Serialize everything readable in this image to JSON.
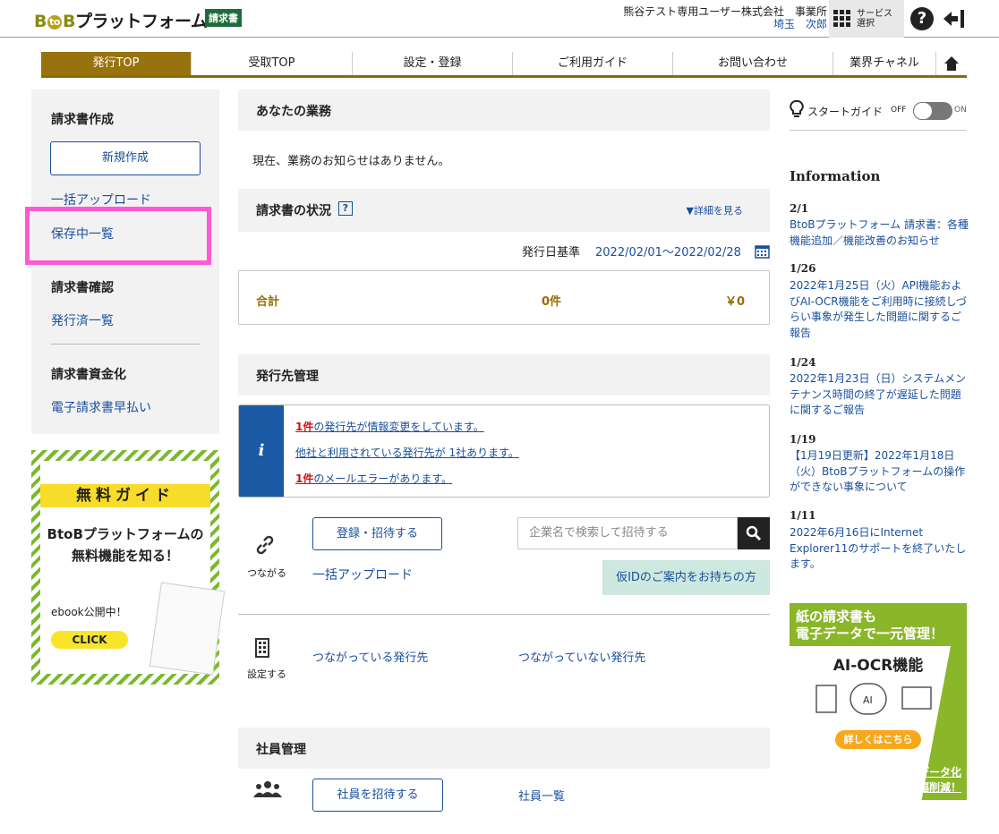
{
  "header": {
    "logo_prefix": "B",
    "logo_to": "to",
    "logo_b": "B",
    "logo_text": "プラットフォーム",
    "logo_badge": "請求書",
    "company_line1": "熊谷テスト専用ユーザー株式会社　事業所",
    "company_line2": "埼玉　次郎",
    "service_label1": "サービス",
    "service_label2": "選択"
  },
  "nav": {
    "items": [
      "発行TOP",
      "受取TOP",
      "設定・登録",
      "ご利用ガイド",
      "お問い合わせ",
      "業界チャネル"
    ]
  },
  "sidebar": {
    "sec1_title": "請求書作成",
    "new_button": "新規作成",
    "bulk_upload": "一括アップロード",
    "saved_list": "保存中一覧",
    "sec2_title": "請求書確認",
    "issued_list": "発行済一覧",
    "sec3_title": "請求書資金化",
    "early_pay": "電子請求書早払い"
  },
  "promo": {
    "title": "無料ガイド",
    "sub1": "BtoBプラットフォームの",
    "sub2": "無料機能を知る！",
    "ebook": "ebook公開中！",
    "click": "CLICK"
  },
  "main": {
    "your_tasks": "あなたの業務",
    "no_notice": "現在、業務のお知らせはありません。",
    "invoice_status": "請求書の状況",
    "details": "▼詳細を見る",
    "date_label": "発行日基準",
    "date_range": "2022/02/01～2022/02/28",
    "total_label": "合計",
    "total_count": "0件",
    "total_amount": "￥0",
    "dest_mgmt": "発行先管理",
    "info_mark": "i",
    "info1_count": "1件",
    "info1_text": "の発行先が情報変更をしています。",
    "info2_text": "他社と利用されている発行先が 1社あります。",
    "info3_count": "1件",
    "info3_text": "のメールエラーがあります。",
    "register_button": "登録・招待する",
    "search_placeholder": "企業名で検索して招待する",
    "connect_label": "つながる",
    "bulk_upload": "一括アップロード",
    "kari_id": "仮IDのご案内をお持ちの方",
    "settings_label": "設定する",
    "connected": "つながっている発行先",
    "not_connected": "つながっていない発行先",
    "staff_mgmt": "社員管理",
    "invite_staff": "社員を招待する",
    "staff_list": "社員一覧"
  },
  "right": {
    "start_guide": "スタートガイド",
    "off": "OFF",
    "on": "ON",
    "info_title": "Information",
    "news": [
      {
        "date": "2/1",
        "text": "BtoBプラットフォーム 請求書：各種機能追加／機能改善のお知らせ"
      },
      {
        "date": "1/26",
        "text": "2022年1月25日（火）API機能およびAI-OCR機能をご利用時に接続しづらい事象が発生した問題に関するご報告"
      },
      {
        "date": "1/24",
        "text": "2022年1月23日（日）システムメンテナンス時間の終了が遅延した問題に関するご報告"
      },
      {
        "date": "1/19",
        "text": "【1月19日更新】2022年1月18日（火）BtoBプラットフォームの操作ができない事象について"
      },
      {
        "date": "1/11",
        "text": "2022年6月16日にInternet Explorer11のサポートを終了いたします。"
      }
    ],
    "ad_line1": "紙の請求書も",
    "ad_line2": "電子データで一元管理！",
    "ad_ocr": "AI-OCR機能",
    "ad_btn": "詳しくはこちら",
    "ad_line3": "簡単・素早く電子データ化",
    "ad_line4": "入力作業が大幅削減！"
  }
}
